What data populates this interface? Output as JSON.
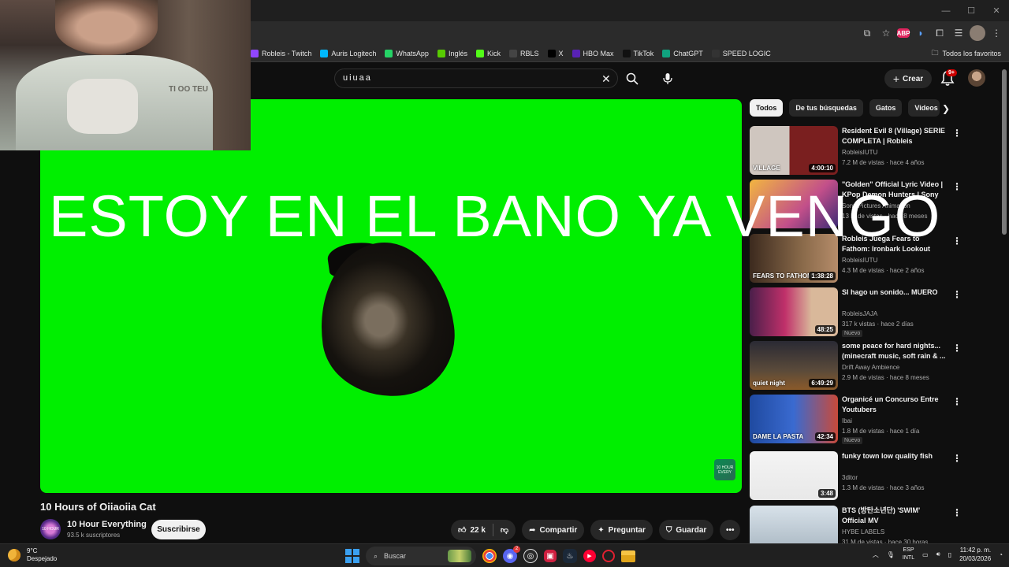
{
  "bookmarks": [
    {
      "label": "Robleis - Twitch",
      "icon": "twitch-icon",
      "color": "#9146ff"
    },
    {
      "label": "Auris Logitech",
      "icon": "logitech-icon",
      "color": "#00b8fc"
    },
    {
      "label": "WhatsApp",
      "icon": "whatsapp-icon",
      "color": "#25d366"
    },
    {
      "label": "Inglés",
      "icon": "check-icon",
      "color": "#58cc02"
    },
    {
      "label": "Kick",
      "icon": "kick-icon",
      "color": "#53fc18"
    },
    {
      "label": "RBLS",
      "icon": "rbls-icon",
      "color": "#444444"
    },
    {
      "label": "X",
      "icon": "x-icon",
      "color": "#000000"
    },
    {
      "label": "HBO Max",
      "icon": "hbo-icon",
      "color": "#5822b4"
    },
    {
      "label": "TikTok",
      "icon": "tiktok-icon",
      "color": "#111111"
    },
    {
      "label": "ChatGPT",
      "icon": "chatgpt-icon",
      "color": "#10a37f"
    },
    {
      "label": "SPEED LOGIC",
      "icon": "speedlogic-icon",
      "color": "#333333"
    }
  ],
  "bookmarks_all": "Todos los favoritos",
  "extension_badge": "ABP",
  "search": {
    "query": "uiuaa"
  },
  "header": {
    "create_label": "Crear",
    "notif_count": "9+"
  },
  "player": {
    "overlay_text": "ESTOY EN EL BANO YA VENGO",
    "watermark": "10 HOUR EVERY"
  },
  "webcam": {
    "shirt_text": "TI OO TEU"
  },
  "video": {
    "title": "10 Hours of Oiiaoiia Cat",
    "channel": "10 Hour Everything",
    "channel_avatar_text": "10 HOUR",
    "subscribers": "93.5 k suscriptores",
    "subscribe_label": "Suscribirse",
    "likes": "22 k",
    "share_label": "Compartir",
    "ask_label": "Preguntar",
    "save_label": "Guardar"
  },
  "chips": [
    "Todos",
    "De tus búsquedas",
    "Gatos",
    "Videos relacionados"
  ],
  "recommendations": [
    {
      "title": "Resident Evil 8 (Village) SERIE COMPLETA | Robleis",
      "channel": "RobleisIUTU",
      "meta": "7.2 M de vistas · hace 4 años",
      "duration": "4:00:10",
      "badge": "",
      "thumb": "linear-gradient(90deg,#cfc6bf 0 45%,#7a1f1f 45% 100%)",
      "thumb_text": "VILLAGE"
    },
    {
      "title": "\"Golden\" Official Lyric Video | KPop Demon Hunters | Sony ...",
      "channel": "Sony Pictures Animation",
      "meta": "13 M de vistas · hace 8 meses",
      "duration": "",
      "badge": "",
      "thumb": "linear-gradient(135deg,#f2b640,#c24f8a 60%,#3b2a74)",
      "thumb_text": ""
    },
    {
      "title": "Robleis Juega Fears to Fathom: Ironbark Lookout",
      "channel": "RobleisIUTU",
      "meta": "4.3 M de vistas · hace 2 años",
      "duration": "1:38:28",
      "badge": "",
      "thumb": "linear-gradient(90deg,#3c2a1e,#8a6a4a 60%,#b58c6a)",
      "thumb_text": "FEARS TO FATHOM"
    },
    {
      "title": "SI hago un sonido... MUERO",
      "channel": "RobleisJAJA",
      "meta": "317 k vistas · hace 2 días",
      "duration": "48:25",
      "badge": "Nuevo",
      "thumb": "linear-gradient(90deg,#4a1f4a,#c0306a 40%,#d9b89a 70%)",
      "thumb_text": ""
    },
    {
      "title": "some peace for hard nights... (minecraft music, soft rain & ...",
      "channel": "Drift Away Ambience",
      "meta": "2.9 M de vistas · hace 8 meses",
      "duration": "6:49:29",
      "badge": "",
      "thumb": "linear-gradient(180deg,#2a2a34,#5a4a3a 60%,#8a5a2a)",
      "thumb_text": "quiet night"
    },
    {
      "title": "Organicé un Concurso Entre Youtubers",
      "channel": "Ibai",
      "meta": "1.8 M de vistas · hace 1 día",
      "duration": "42:34",
      "badge": "Nuevo",
      "thumb": "linear-gradient(90deg,#1f4aa0,#3a6ad0 50%,#c94a3a)",
      "thumb_text": "DAME LA PASTA"
    },
    {
      "title": "funky town low quality fish",
      "channel": "3ditor",
      "meta": "1.3 M de vistas · hace 3 años",
      "duration": "3:48",
      "badge": "",
      "thumb": "linear-gradient(180deg,#f4f4f4,#e8e8e8)",
      "thumb_text": ""
    },
    {
      "title": "BTS (방탄소년단) 'SWIM' Official MV",
      "channel": "HYBE LABELS",
      "meta": "31 M de vistas · hace 30 horas",
      "duration": "",
      "badge": "",
      "thumb": "linear-gradient(180deg,#d8e2ea,#a6b4bf)",
      "thumb_text": ""
    }
  ],
  "taskbar": {
    "temp": "9°C",
    "weather": "Despejado",
    "search_placeholder": "Buscar",
    "lang1": "ESP",
    "lang2": "INTL",
    "time": "11:42 p. m.",
    "date": "20/03/2026",
    "discord_badge": "2"
  }
}
